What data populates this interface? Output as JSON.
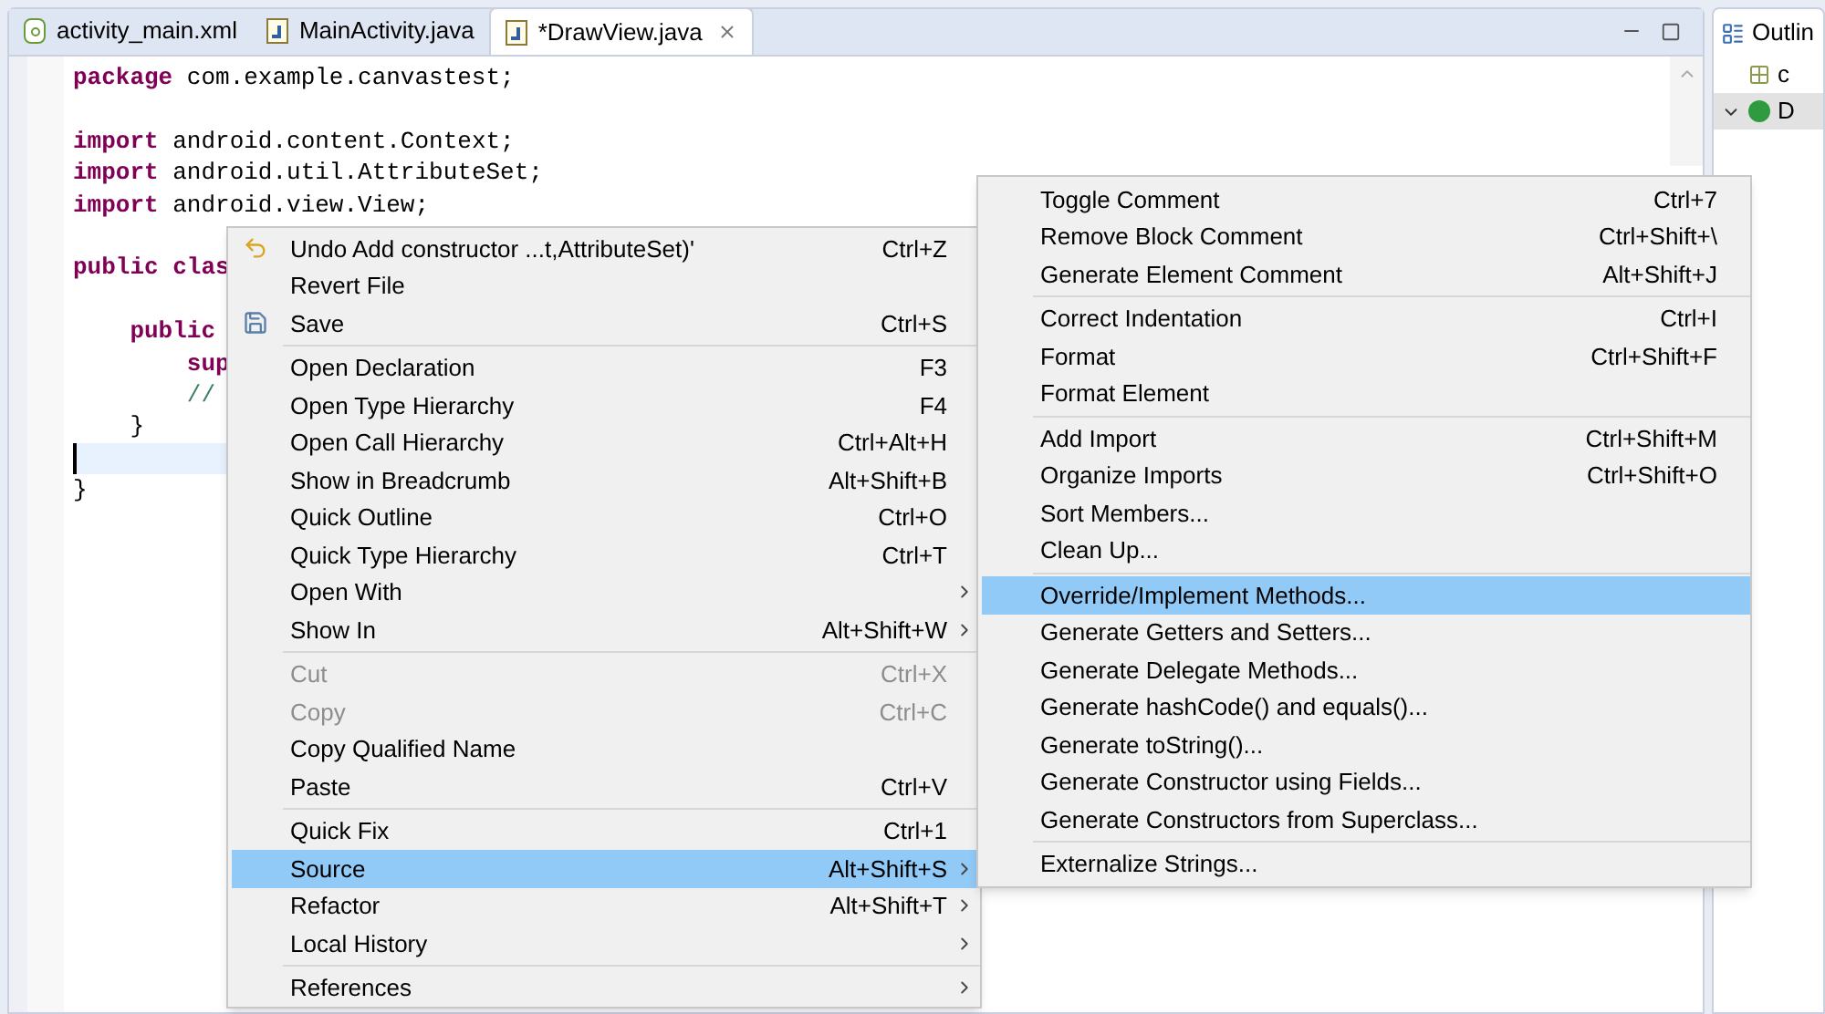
{
  "editor_tabs": [
    {
      "label": "activity_main.xml",
      "kind": "xml",
      "selected": false,
      "closable": false
    },
    {
      "label": "MainActivity.java",
      "kind": "java",
      "selected": false,
      "closable": false
    },
    {
      "label": "*DrawView.java",
      "kind": "java",
      "selected": true,
      "closable": true
    }
  ],
  "code_lines": [
    {
      "kind": "code",
      "segments": [
        {
          "kind": "keyword",
          "text": "package"
        },
        {
          "kind": "plain",
          "text": " com.example.canvastest;"
        }
      ]
    },
    {
      "kind": "blank"
    },
    {
      "kind": "code",
      "segments": [
        {
          "kind": "keyword",
          "text": "import"
        },
        {
          "kind": "plain",
          "text": " android.content.Context;"
        }
      ]
    },
    {
      "kind": "code",
      "segments": [
        {
          "kind": "keyword",
          "text": "import"
        },
        {
          "kind": "plain",
          "text": " android.util.AttributeSet;"
        }
      ]
    },
    {
      "kind": "code",
      "segments": [
        {
          "kind": "keyword",
          "text": "import"
        },
        {
          "kind": "plain",
          "text": " android.view.View;"
        }
      ]
    },
    {
      "kind": "blank"
    },
    {
      "kind": "code",
      "segments": [
        {
          "kind": "keyword",
          "text": "public clas"
        }
      ]
    },
    {
      "kind": "blank"
    },
    {
      "kind": "code",
      "segments": [
        {
          "kind": "keyword",
          "text": "    public"
        }
      ]
    },
    {
      "kind": "code",
      "segments": [
        {
          "kind": "keyword",
          "text": "        sup"
        }
      ]
    },
    {
      "kind": "code",
      "segments": [
        {
          "kind": "comment",
          "text": "        //"
        }
      ]
    },
    {
      "kind": "code",
      "segments": [
        {
          "kind": "plain",
          "text": "    }"
        }
      ]
    },
    {
      "kind": "current"
    },
    {
      "kind": "code",
      "segments": [
        {
          "kind": "plain",
          "text": "}"
        }
      ]
    }
  ],
  "context_menu": [
    {
      "kind": "undo_item",
      "label": "Undo Add constructor ...t,AttributeSet)'",
      "shortcut": "Ctrl+Z",
      "disabled": false,
      "selected": false,
      "submenu": false
    },
    {
      "kind": "item",
      "label": "Revert File",
      "disabled": false,
      "selected": false,
      "submenu": false
    },
    {
      "kind": "save_item",
      "label": "Save",
      "shortcut": "Ctrl+S",
      "disabled": false,
      "selected": false,
      "submenu": false
    },
    {
      "kind": "separator"
    },
    {
      "kind": "item",
      "label": "Open Declaration",
      "shortcut": "F3",
      "disabled": false,
      "selected": false,
      "submenu": false
    },
    {
      "kind": "item",
      "label": "Open Type Hierarchy",
      "shortcut": "F4",
      "disabled": false,
      "selected": false,
      "submenu": false
    },
    {
      "kind": "item",
      "label": "Open Call Hierarchy",
      "shortcut": "Ctrl+Alt+H",
      "disabled": false,
      "selected": false,
      "submenu": false
    },
    {
      "kind": "item",
      "label": "Show in Breadcrumb",
      "shortcut": "Alt+Shift+B",
      "disabled": false,
      "selected": false,
      "submenu": false
    },
    {
      "kind": "item",
      "label": "Quick Outline",
      "shortcut": "Ctrl+O",
      "disabled": false,
      "selected": false,
      "submenu": false
    },
    {
      "kind": "item",
      "label": "Quick Type Hierarchy",
      "shortcut": "Ctrl+T",
      "disabled": false,
      "selected": false,
      "submenu": false
    },
    {
      "kind": "item",
      "label": "Open With",
      "disabled": false,
      "selected": false,
      "submenu": true
    },
    {
      "kind": "item",
      "label": "Show In",
      "shortcut": "Alt+Shift+W",
      "disabled": false,
      "selected": false,
      "submenu": true
    },
    {
      "kind": "separator"
    },
    {
      "kind": "item",
      "label": "Cut",
      "shortcut": "Ctrl+X",
      "disabled": true,
      "selected": false,
      "submenu": false
    },
    {
      "kind": "item",
      "label": "Copy",
      "shortcut": "Ctrl+C",
      "disabled": true,
      "selected": false,
      "submenu": false
    },
    {
      "kind": "item",
      "label": "Copy Qualified Name",
      "disabled": false,
      "selected": false,
      "submenu": false
    },
    {
      "kind": "item",
      "label": "Paste",
      "shortcut": "Ctrl+V",
      "disabled": false,
      "selected": false,
      "submenu": false
    },
    {
      "kind": "separator"
    },
    {
      "kind": "item",
      "label": "Quick Fix",
      "shortcut": "Ctrl+1",
      "disabled": false,
      "selected": false,
      "submenu": false
    },
    {
      "kind": "item",
      "label": "Source",
      "shortcut": "Alt+Shift+S",
      "disabled": false,
      "selected": true,
      "submenu": true
    },
    {
      "kind": "item",
      "label": "Refactor",
      "shortcut": "Alt+Shift+T",
      "disabled": false,
      "selected": false,
      "submenu": true
    },
    {
      "kind": "item",
      "label": "Local History",
      "disabled": false,
      "selected": false,
      "submenu": true
    },
    {
      "kind": "separator"
    },
    {
      "kind": "item",
      "label": "References",
      "disabled": false,
      "selected": false,
      "submenu": true
    }
  ],
  "source_submenu": [
    {
      "kind": "item",
      "label": "Toggle Comment",
      "shortcut": "Ctrl+7",
      "selected": false
    },
    {
      "kind": "item",
      "label": "Remove Block Comment",
      "shortcut": "Ctrl+Shift+\\",
      "selected": false
    },
    {
      "kind": "item",
      "label": "Generate Element Comment",
      "shortcut": "Alt+Shift+J",
      "selected": false
    },
    {
      "kind": "separator"
    },
    {
      "kind": "item",
      "label": "Correct Indentation",
      "shortcut": "Ctrl+I",
      "selected": false
    },
    {
      "kind": "item",
      "label": "Format",
      "shortcut": "Ctrl+Shift+F",
      "selected": false
    },
    {
      "kind": "item",
      "label": "Format Element",
      "selected": false
    },
    {
      "kind": "separator"
    },
    {
      "kind": "item",
      "label": "Add Import",
      "shortcut": "Ctrl+Shift+M",
      "selected": false
    },
    {
      "kind": "item",
      "label": "Organize Imports",
      "shortcut": "Ctrl+Shift+O",
      "selected": false
    },
    {
      "kind": "item",
      "label": "Sort Members...",
      "selected": false
    },
    {
      "kind": "item",
      "label": "Clean Up...",
      "selected": false
    },
    {
      "kind": "separator"
    },
    {
      "kind": "item",
      "label": "Override/Implement Methods...",
      "selected": true
    },
    {
      "kind": "item",
      "label": "Generate Getters and Setters...",
      "selected": false
    },
    {
      "kind": "item",
      "label": "Generate Delegate Methods...",
      "selected": false
    },
    {
      "kind": "item",
      "label": "Generate hashCode() and equals()...",
      "selected": false
    },
    {
      "kind": "item",
      "label": "Generate toString()...",
      "selected": false
    },
    {
      "kind": "item",
      "label": "Generate Constructor using Fields...",
      "selected": false
    },
    {
      "kind": "item",
      "label": "Generate Constructors from Superclass...",
      "selected": false
    },
    {
      "kind": "separator"
    },
    {
      "kind": "item",
      "label": "Externalize Strings...",
      "selected": false
    }
  ],
  "outline": {
    "title": "Outlin",
    "items": [
      {
        "kind": "imports",
        "label": "c",
        "selected": false,
        "expanded": false
      },
      {
        "kind": "class",
        "label": "D",
        "selected": true,
        "expanded": true
      }
    ]
  }
}
